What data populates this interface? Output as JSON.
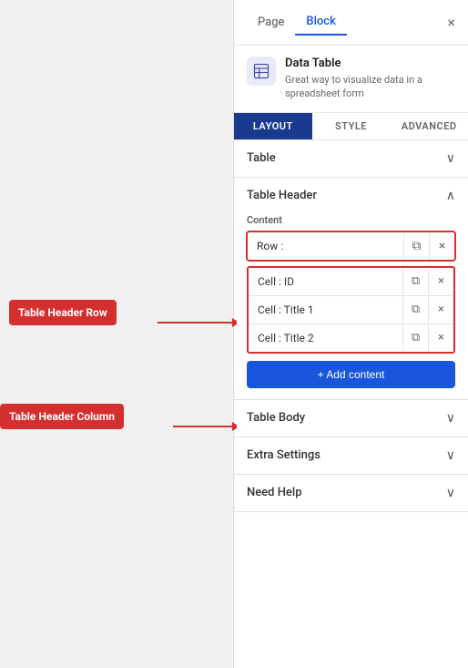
{
  "header": {
    "tab_page": "Page",
    "tab_block": "Block",
    "close_label": "×"
  },
  "block_info": {
    "title": "Data Table",
    "description": "Great way to visualize data in a spreadsheet form"
  },
  "layout_tabs": [
    {
      "label": "LAYOUT",
      "active": true
    },
    {
      "label": "STYLE",
      "active": false
    },
    {
      "label": "ADVANCED",
      "active": false
    }
  ],
  "sections": {
    "table": {
      "label": "Table",
      "collapsed": true
    },
    "table_header": {
      "label": "Table Header",
      "collapsed": false,
      "content_label": "Content",
      "row": {
        "label": "Row :"
      },
      "cells": [
        {
          "label": "Cell : ID"
        },
        {
          "label": "Cell : Title 1"
        },
        {
          "label": "Cell : Title 2"
        }
      ],
      "add_button": "+ Add content"
    },
    "table_body": {
      "label": "Table Body",
      "collapsed": true
    },
    "extra_settings": {
      "label": "Extra Settings",
      "collapsed": true
    },
    "need_help": {
      "label": "Need Help",
      "collapsed": true
    }
  },
  "annotations": {
    "table_header_row": "Table Header Row",
    "table_header_column": "Table Header Column"
  },
  "icons": {
    "copy": "⧉",
    "close": "×",
    "chevron_down": "∨",
    "chevron_up": "∧"
  }
}
